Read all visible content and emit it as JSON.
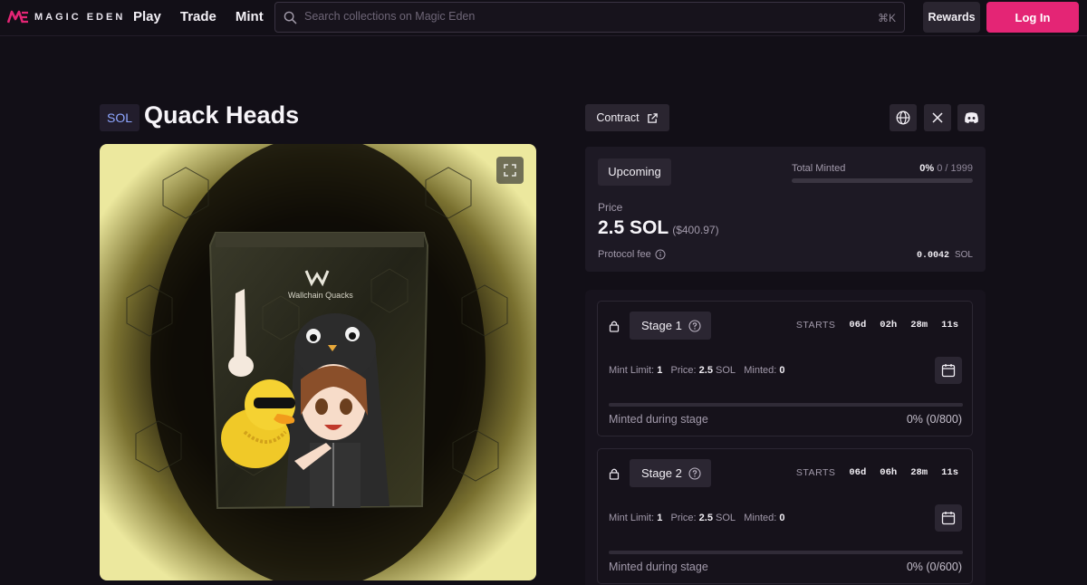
{
  "header": {
    "brand": "MAGIC EDEN",
    "nav": [
      "Play",
      "Trade",
      "Mint"
    ],
    "search_placeholder": "Search collections on Magic Eden",
    "search_shortcut": "⌘K",
    "rewards_label": "Rewards",
    "login_label": "Log In"
  },
  "collection": {
    "chain": "SOL",
    "title": "Quack Heads",
    "art_brand": "Wallchain Quacks"
  },
  "actions": {
    "contract_label": "Contract",
    "social_icons": [
      "globe-icon",
      "x-icon",
      "discord-icon"
    ]
  },
  "mint": {
    "status": "Upcoming",
    "total_minted_label": "Total Minted",
    "total_minted_pct": "0%",
    "total_minted_count": "0 / 1999",
    "total_minted_fraction": 0,
    "price_label": "Price",
    "price": "2.5 SOL",
    "price_usd": "($400.97)",
    "fee_label": "Protocol fee",
    "fee_value": "0.0042",
    "fee_unit": "SOL"
  },
  "stages": [
    {
      "name": "Stage 1",
      "starts_label": "STARTS",
      "countdown": [
        "06d",
        "02h",
        "28m",
        "11s"
      ],
      "mint_limit_label": "Mint Limit:",
      "mint_limit": "1",
      "price_label": "Price:",
      "price": "2.5",
      "price_unit": "SOL",
      "minted_label": "Minted:",
      "minted": "0",
      "progress_label": "Minted during stage",
      "progress_value": "0% (0/800)",
      "progress_fraction": 0
    },
    {
      "name": "Stage 2",
      "starts_label": "STARTS",
      "countdown": [
        "06d",
        "06h",
        "28m",
        "11s"
      ],
      "mint_limit_label": "Mint Limit:",
      "mint_limit": "1",
      "price_label": "Price:",
      "price": "2.5",
      "price_unit": "SOL",
      "minted_label": "Minted:",
      "minted": "0",
      "progress_label": "Minted during stage",
      "progress_value": "0% (0/600)",
      "progress_fraction": 0
    }
  ],
  "colors": {
    "background": "#120f17",
    "panel": "#1d1924",
    "accent_pink": "#e42575",
    "sol_badge_text": "#8ea6ff"
  }
}
